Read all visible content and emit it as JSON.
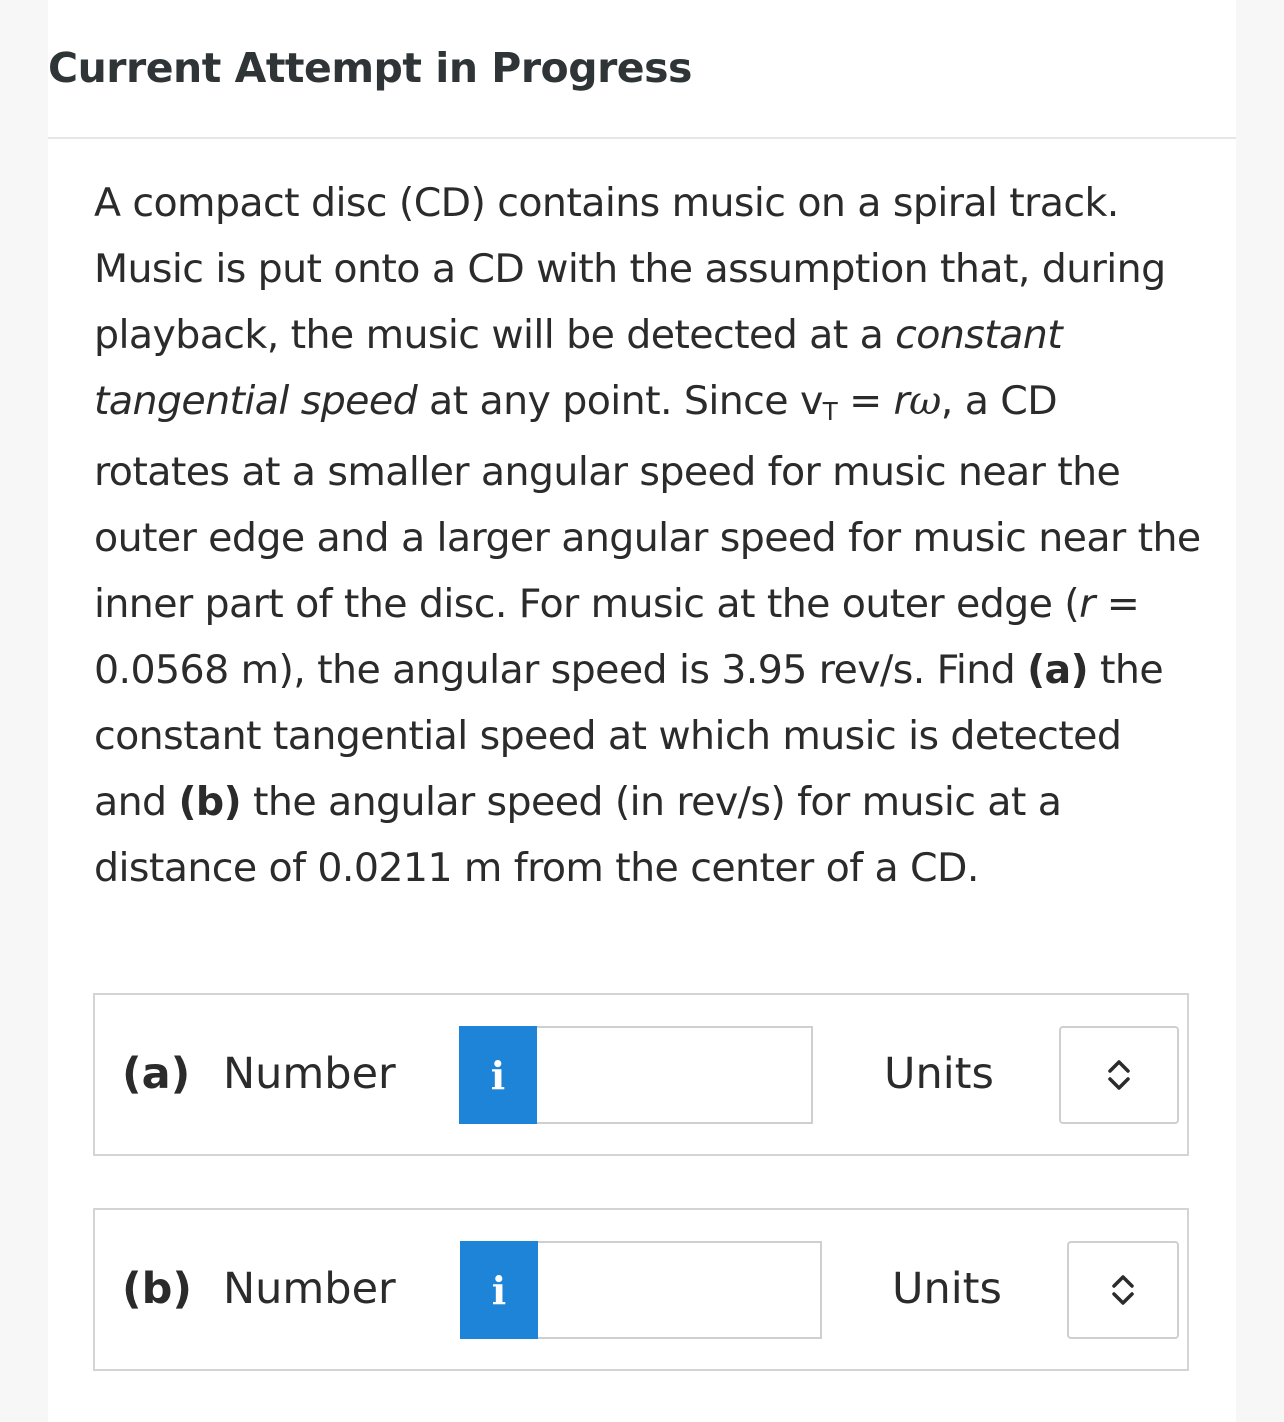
{
  "header": {
    "title": "Current Attempt in Progress"
  },
  "question": {
    "s1": "A compact disc (CD) contains music on a spiral track. Music is put onto a CD with the assumption that, during playback, the music will be detected at a ",
    "s2": "constant tangential speed",
    "s3": " at any point. Since ",
    "v": "v",
    "v_sub": "T",
    "eq": " = ",
    "r": "r",
    "omega": "ω",
    "s4": ", a CD rotates at a smaller angular speed for music near the outer edge and a larger angular speed for music near the inner part of the disc. For music at the outer edge (",
    "r2": "r",
    "s5": " = 0.0568 m), the angular speed is 3.95 rev/s. Find ",
    "a_label": "(a)",
    "s6": " the constant tangential speed at which music is detected and ",
    "b_label": "(b)",
    "s7": " the angular speed (in rev/s) for music at a distance of 0.0211 m from the center of a CD."
  },
  "answers": [
    {
      "part": "(a)",
      "number_label": "Number",
      "info_icon": "i",
      "value": "",
      "units_label": "Units",
      "units_value": ""
    },
    {
      "part": "(b)",
      "number_label": "Number",
      "info_icon": "i",
      "value": "",
      "units_label": "Units",
      "units_value": ""
    }
  ],
  "colors": {
    "info_button": "#1d84d8",
    "border": "#d4d4d4"
  }
}
